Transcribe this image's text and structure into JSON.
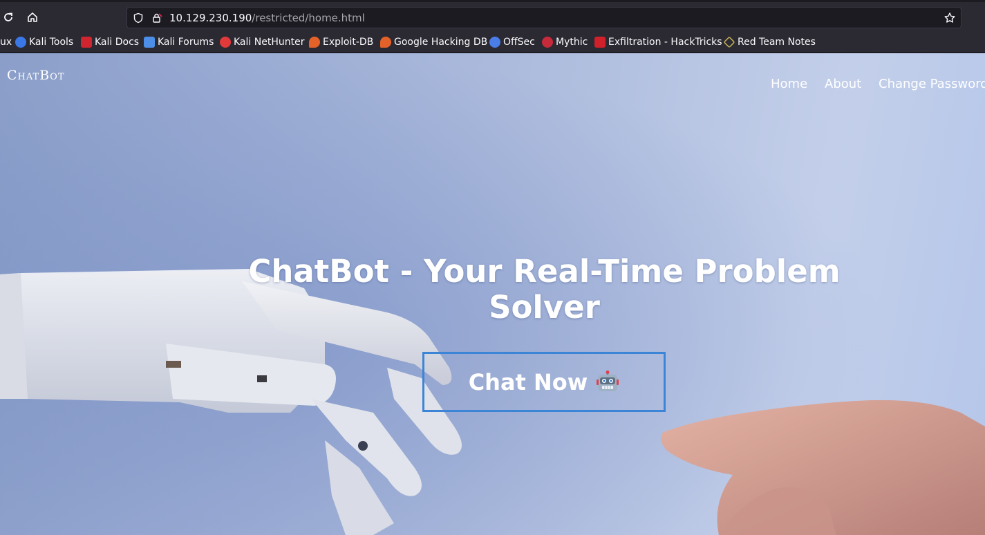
{
  "browser": {
    "url_host": "10.129.230.190",
    "url_path": "/restricted/home.html",
    "icons": [
      "reload-icon",
      "home-icon",
      "shield-icon",
      "lock-warning-icon",
      "bookmark-star-icon"
    ]
  },
  "bookmarks": [
    {
      "label": "ux",
      "icon": "kali-icon",
      "color": "#2b2a33"
    },
    {
      "label": "Kali Tools",
      "icon": "kali-tools-icon",
      "color": "#3b78e7"
    },
    {
      "label": "Kali Docs",
      "icon": "kali-docs-icon",
      "color": "#d0252e"
    },
    {
      "label": "Kali Forums",
      "icon": "kali-forums-icon",
      "color": "#4c8ee8"
    },
    {
      "label": "Kali NetHunter",
      "icon": "nethunter-icon",
      "color": "#e23a3a"
    },
    {
      "label": "Exploit-DB",
      "icon": "exploit-db-icon",
      "color": "#e4622a"
    },
    {
      "label": "Google Hacking DB",
      "icon": "ghdb-icon",
      "color": "#e4622a"
    },
    {
      "label": "OffSec",
      "icon": "offsec-icon",
      "color": "#4a7de8"
    },
    {
      "label": "Mythic",
      "icon": "mythic-icon",
      "color": "#c72a3a"
    },
    {
      "label": "Exfiltration - HackTricks",
      "icon": "hacktricks-icon",
      "color": "#d0202a"
    },
    {
      "label": "Red Team Notes",
      "icon": "redteam-icon",
      "color": "#c9b457"
    }
  ],
  "site": {
    "brand": "ChatBot",
    "nav": [
      "Home",
      "About",
      "Change Password"
    ],
    "hero_title": "ChatBot - Your Real-Time Problem Solver",
    "cta_label": "Chat Now",
    "cta_icon": "robot-icon",
    "accent_color": "#3c85d6"
  }
}
